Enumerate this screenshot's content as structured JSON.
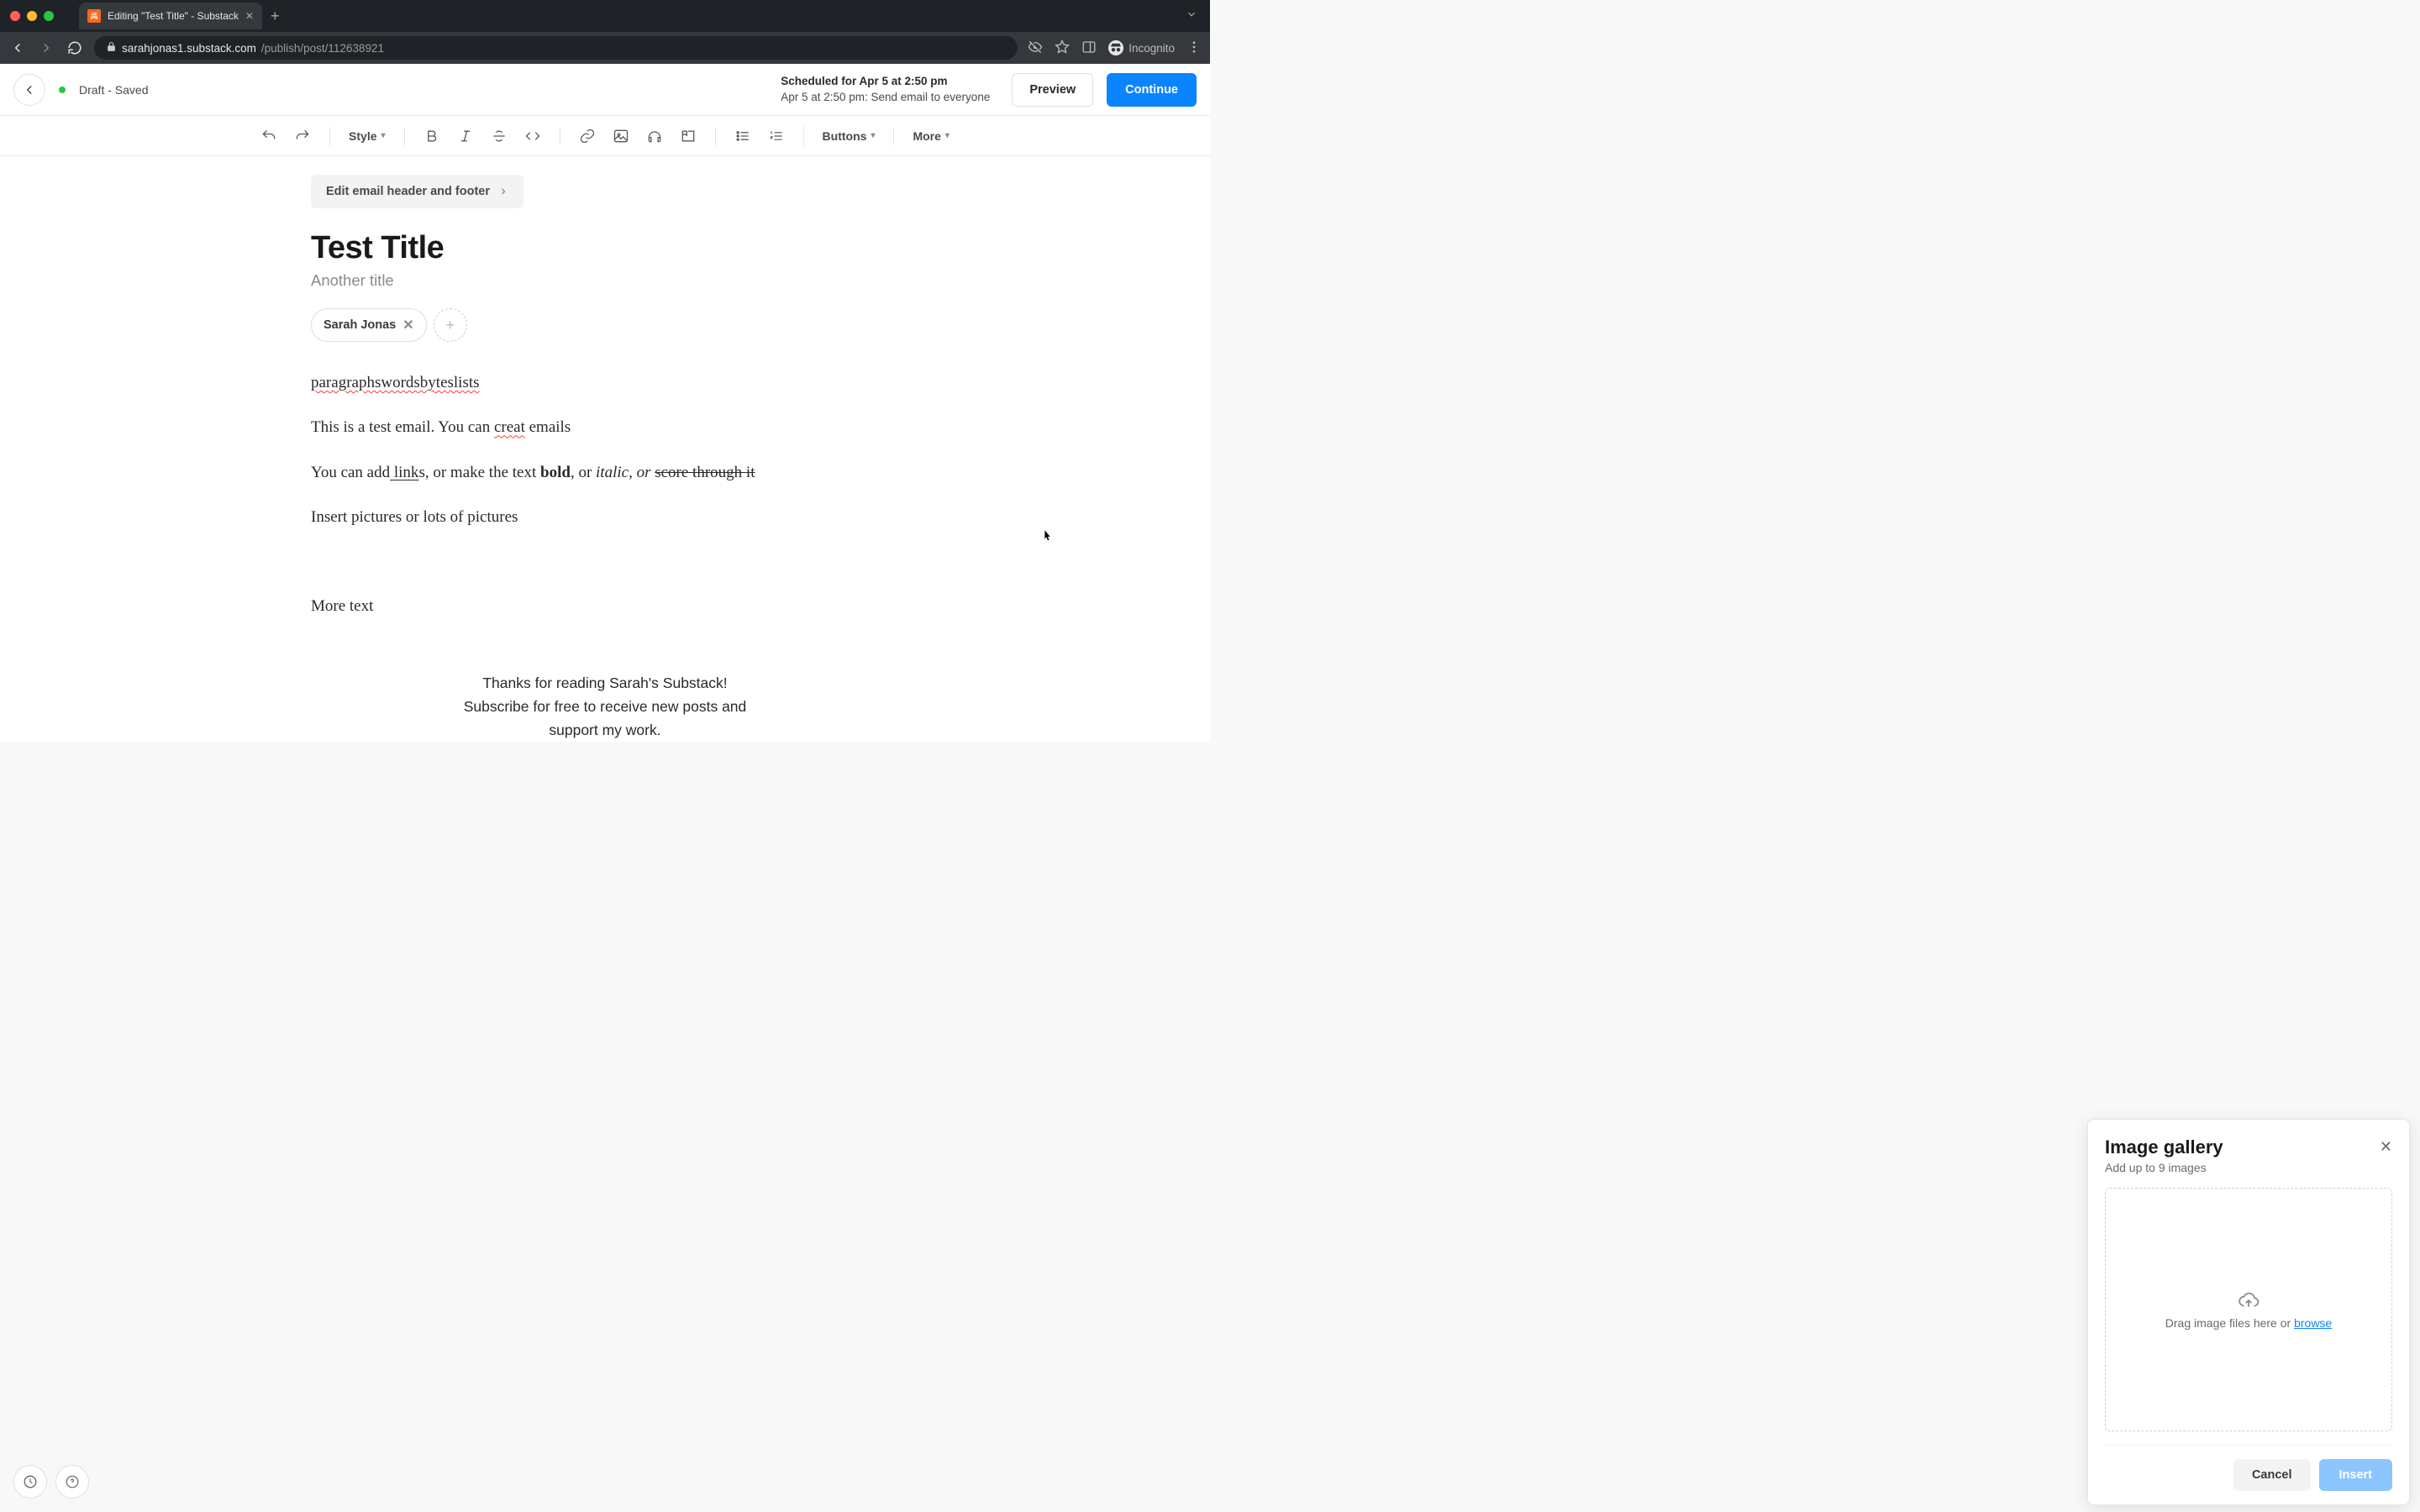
{
  "browser": {
    "tab_title": "Editing \"Test Title\" - Substack",
    "url_host": "sarahjonas1.substack.com",
    "url_path": "/publish/post/112638921",
    "incognito_label": "Incognito"
  },
  "header": {
    "draft_status": "Draft - Saved",
    "scheduled_title": "Scheduled for Apr 5 at 2:50 pm",
    "scheduled_detail": "Apr 5 at 2:50 pm: Send email to everyone",
    "preview_label": "Preview",
    "continue_label": "Continue"
  },
  "toolbar": {
    "style": "Style",
    "buttons": "Buttons",
    "more": "More"
  },
  "editor": {
    "edit_header_footer": "Edit email header and footer",
    "title": "Test Title",
    "subtitle": "Another title",
    "author_name": "Sarah Jonas",
    "p1": "paragraphswordsbyteslists",
    "p2_a": "This is a test email. You can ",
    "p2_spell": "creat",
    "p2_b": " emails",
    "p3_a": "You can add",
    "p3_link": " link",
    "p3_b": "s, or make the text ",
    "p3_bold": "bold",
    "p3_c": ", or ",
    "p3_italic": "italic, or ",
    "p3_strike": "score through it",
    "p4": "Insert pictures or lots of pictures",
    "p5": "More text",
    "thanks_l1": "Thanks for reading Sarah's Substack!",
    "thanks_l2": "Subscribe for free to receive new posts and",
    "thanks_l3": "support my work."
  },
  "gallery": {
    "title": "Image gallery",
    "subtitle": "Add up to 9 images",
    "drop_text": "Drag image files here or ",
    "browse": "browse",
    "cancel": "Cancel",
    "insert": "Insert"
  }
}
